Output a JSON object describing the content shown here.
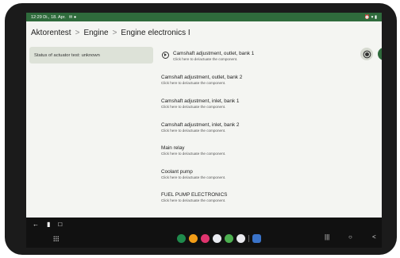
{
  "status_bar": {
    "time_date": "12:29 Di., 18. Apr.",
    "notif_icons": "✉ ●",
    "right_icons": "⏰ ▾ ▮"
  },
  "breadcrumb": {
    "items": [
      "Aktorentest",
      "Engine",
      "Engine electronics I"
    ],
    "separator": ">"
  },
  "status_panel": {
    "text": "Status of actuator test: unknown"
  },
  "components": [
    {
      "title": "Camshaft adjustment, outlet, bank 1",
      "subtitle": "Click here to de/actuate the component."
    },
    {
      "title": "Camshaft adjustment, outlet, bank 2",
      "subtitle": "Click here to de/actuate the component."
    },
    {
      "title": "Camshaft adjustment, inlet, bank 1",
      "subtitle": "Click here to de/actuate the component."
    },
    {
      "title": "Camshaft adjustment, inlet, bank 2",
      "subtitle": "Click here to de/actuate the component."
    },
    {
      "title": "Main relay",
      "subtitle": "Click here to de/actuate the component."
    },
    {
      "title": "Coolant pump",
      "subtitle": "Click here to de/actuate the component."
    },
    {
      "title": "FUEL PUMP ELECTRONICS",
      "subtitle": "Click here to de/actuate the component."
    }
  ],
  "nav_top": {
    "back": "←",
    "phone": "▮",
    "window": "□"
  },
  "dock_apps": [
    {
      "name": "app-green",
      "color": "#1f8a4c"
    },
    {
      "name": "app-orange",
      "color": "#f29d17"
    },
    {
      "name": "app-pink",
      "color": "#e0346e"
    },
    {
      "name": "app-gmail",
      "color": "#e8eaf0"
    },
    {
      "name": "app-chrome",
      "color": "#4caf50"
    },
    {
      "name": "app-play",
      "color": "#e9e9ee"
    },
    {
      "name": "app-settings",
      "color": "#3a73c9"
    }
  ],
  "system_nav": {
    "recents": "|||",
    "home": "○",
    "back": "<"
  }
}
